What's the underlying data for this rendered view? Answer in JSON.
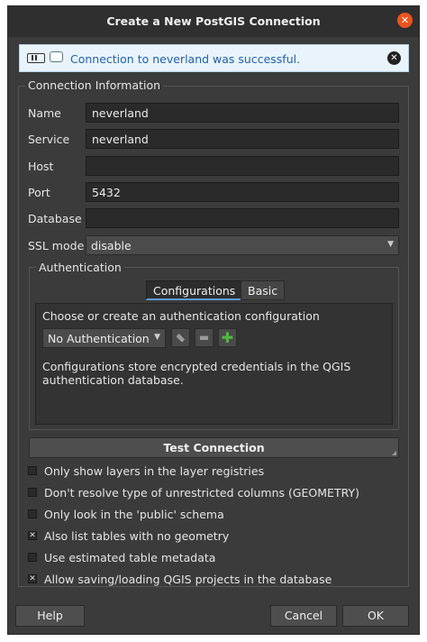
{
  "window": {
    "title": "Create a New PostGIS Connection"
  },
  "message": {
    "text": "Connection to neverland was successful."
  },
  "connection": {
    "group_title": "Connection Information",
    "fields": [
      {
        "label": "Name",
        "value": "neverland"
      },
      {
        "label": "Service",
        "value": "neverland"
      },
      {
        "label": "Host",
        "value": ""
      },
      {
        "label": "Port",
        "value": "5432"
      },
      {
        "label": "Database",
        "value": ""
      }
    ],
    "ssl_label": "SSL mode",
    "ssl_value": "disable"
  },
  "auth": {
    "group_title": "Authentication",
    "tabs": [
      {
        "label": "Configurations"
      },
      {
        "label": "Basic"
      }
    ],
    "prompt": "Choose or create an authentication configuration",
    "selected": "No Authentication",
    "note": "Configurations store encrypted credentials in the QGIS authentication database."
  },
  "test_button": "Test Connection",
  "options": [
    {
      "label": "Only show layers in the layer registries",
      "checked": false
    },
    {
      "label": "Don't resolve type of unrestricted columns (GEOMETRY)",
      "checked": false
    },
    {
      "label": "Only look in the 'public' schema",
      "checked": false
    },
    {
      "label": "Also list tables with no geometry",
      "checked": true
    },
    {
      "label": "Use estimated table metadata",
      "checked": false
    },
    {
      "label": "Allow saving/loading QGIS projects in the database",
      "checked": true
    }
  ],
  "buttons": {
    "help": "Help",
    "cancel": "Cancel",
    "ok": "OK"
  },
  "colors": {
    "accent": "#5b9bd5",
    "close": "#e95420",
    "message_text": "#2264a6",
    "window_bg": "#3b3b3b"
  }
}
